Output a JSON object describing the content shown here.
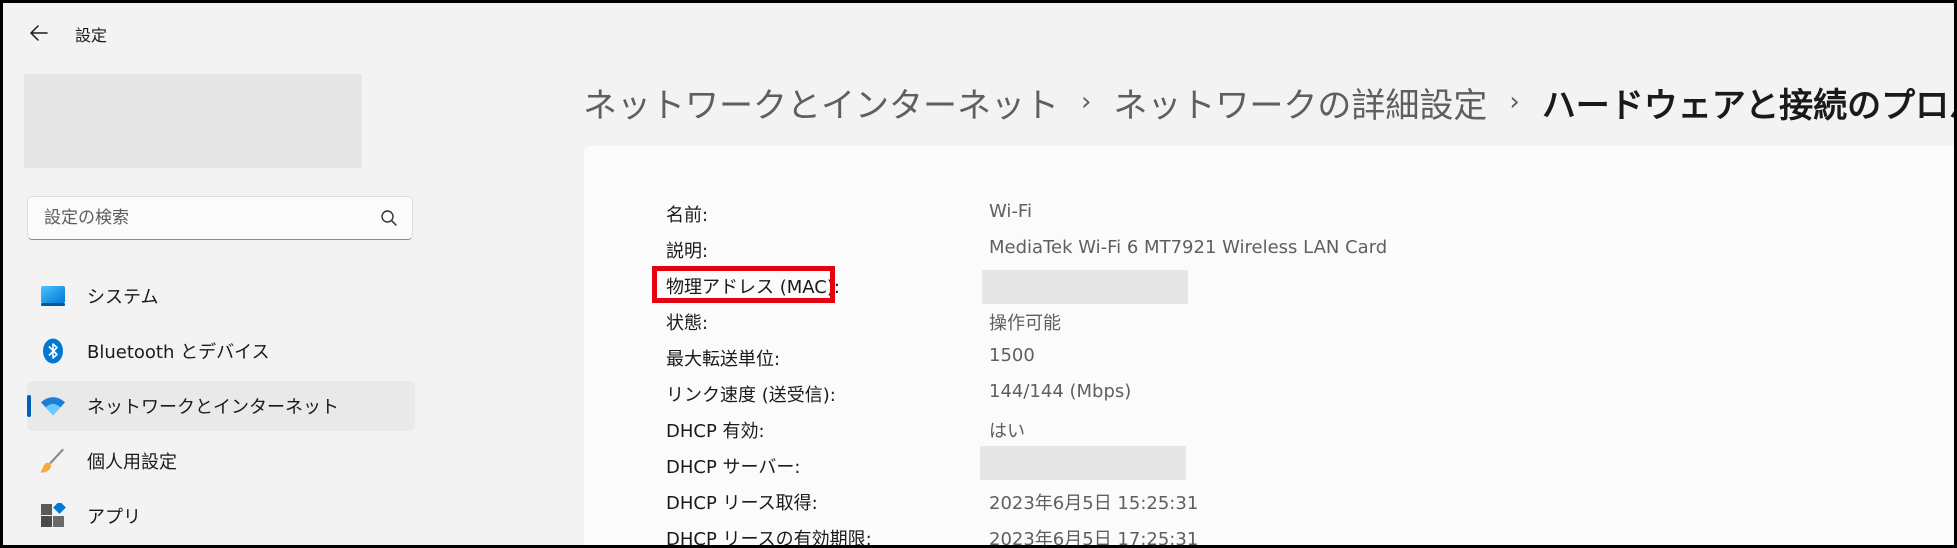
{
  "window": {
    "title": "設定",
    "back_icon": "back-arrow-icon"
  },
  "search": {
    "placeholder": "設定の検索",
    "icon": "search-icon"
  },
  "sidebar": {
    "items": [
      {
        "label": "システム",
        "icon": "monitor-icon",
        "active": false
      },
      {
        "label": "Bluetooth とデバイス",
        "icon": "bluetooth-icon",
        "active": false
      },
      {
        "label": "ネットワークとインターネット",
        "icon": "wifi-icon",
        "active": true
      },
      {
        "label": "個人用設定",
        "icon": "brush-icon",
        "active": false
      },
      {
        "label": "アプリ",
        "icon": "apps-icon",
        "active": false
      }
    ]
  },
  "breadcrumb": {
    "items": [
      "ネットワークとインターネット",
      "ネットワークの詳細設定",
      "ハードウェアと接続のプロパティ"
    ],
    "separator": "›"
  },
  "properties": [
    {
      "label": "名前:",
      "value": "Wi-Fi"
    },
    {
      "label": "説明:",
      "value": "MediaTek Wi-Fi 6 MT7921 Wireless LAN Card"
    },
    {
      "label": "物理アドレス (MAC):",
      "value": ""
    },
    {
      "label": "状態:",
      "value": "操作可能"
    },
    {
      "label": "最大転送単位:",
      "value": "1500"
    },
    {
      "label": "リンク速度 (送受信):",
      "value": "144/144 (Mbps)"
    },
    {
      "label": "DHCP 有効:",
      "value": "はい"
    },
    {
      "label": "DHCP サーバー:",
      "value": ""
    },
    {
      "label": "DHCP リース取得:",
      "value": "2023年6月5日 15:25:31"
    },
    {
      "label": "DHCP リースの有効期限:",
      "value": "2023年6月5日 17:25:31"
    }
  ],
  "colors": {
    "accent": "#005fb8",
    "highlight": "#e60012",
    "background": "#f3f3f3",
    "panel": "#fbfbfb"
  }
}
